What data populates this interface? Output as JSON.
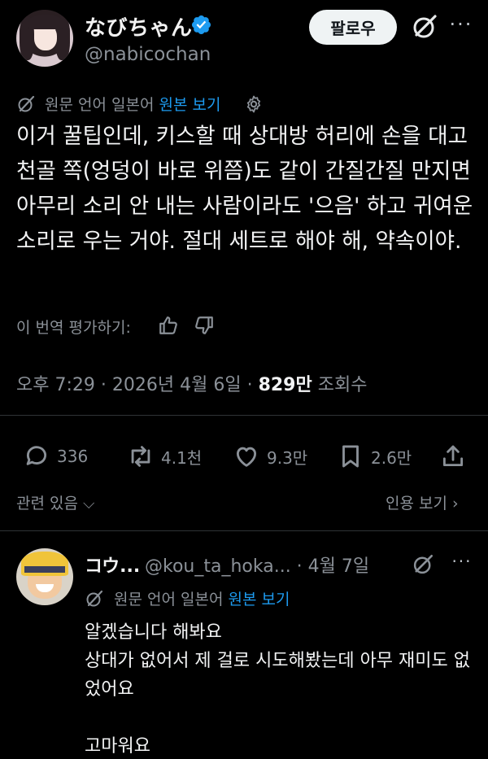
{
  "author": {
    "display_name": "なびちゃん",
    "handle": "@nabicochan"
  },
  "header": {
    "follow_label": "팔로우",
    "more_label": "···"
  },
  "translation": {
    "prefix": "원문 언어 일본어 ",
    "link": "원본 보기"
  },
  "tweet": {
    "text": "이거 꿀팁인데, 키스할 때 상대방 허리에 손을 대고 천골 쪽(엉덩이 바로 위쯤)도 같이 간질간질 만지면 아무리 소리 안 내는 사람이라도 '으음' 하고 귀여운 소리로 우는 거야. 절대 세트로 해야 해, 약속이야."
  },
  "rate": {
    "label": "이 번역 평가하기:"
  },
  "meta": {
    "time": "오후 7:29",
    "date": "2026년 4월 6일",
    "views_count": "829만",
    "views_label": "조회수",
    "sep": " · "
  },
  "actions": {
    "replies": "336",
    "reposts": "4.1천",
    "likes": "9.3만",
    "bookmarks": "2.6만"
  },
  "related": {
    "left": "관련 있음",
    "right": "인용 보기"
  },
  "reply": {
    "name": "コウ...",
    "handle": "@kou_ta_hoka...",
    "date": " · 4월 7일",
    "more_label": "···",
    "translation_prefix": "원문 언어 일본어 ",
    "translation_link": "원본 보기",
    "lines": [
      "알겠습니다 해봐요",
      "상대가 없어서 제 걸로 시도해봤는데 아무 재미도 없었어요",
      "",
      "고마워요"
    ]
  },
  "colors": {
    "background": "#000000",
    "text": "#f2f3f4",
    "muted": "#8b9198",
    "link": "#1d9bf0",
    "divider": "#2f3336"
  }
}
